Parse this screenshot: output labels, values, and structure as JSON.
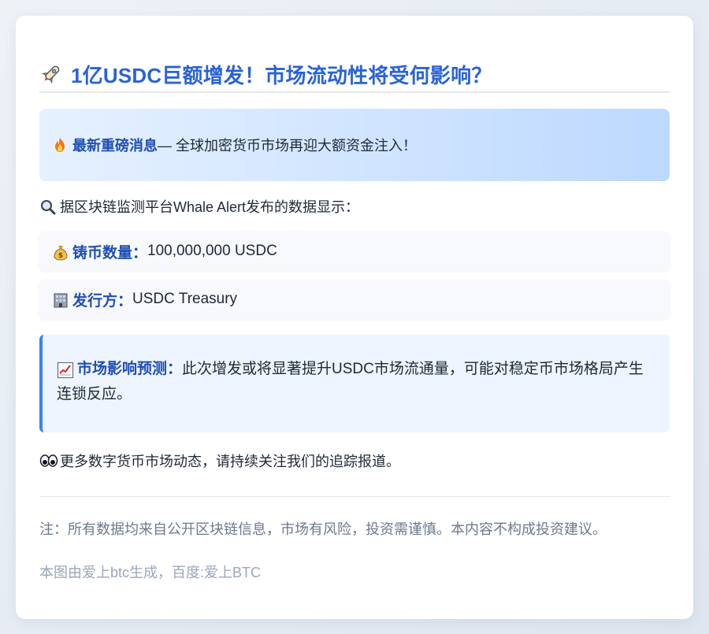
{
  "header": {
    "title": "1亿USDC巨额增发！市场流动性将受何影响？",
    "icon": "rocket-icon"
  },
  "breaking": {
    "icon": "fire-icon",
    "label": "最新重磅消息",
    "text": " — 全球加密货币市场再迎大额资金注入！"
  },
  "source": {
    "icon": "magnifier-icon",
    "text": "据区块链监测平台Whale Alert发布的数据显示："
  },
  "stats": [
    {
      "icon": "money-bag-icon",
      "label": "铸币数量：",
      "value": "100,000,000 USDC"
    },
    {
      "icon": "office-building-icon",
      "label": "发行方：",
      "value": "USDC Treasury"
    }
  ],
  "impact": {
    "icon": "chart-up-icon",
    "label": "市场影响预测：",
    "text": "此次增发或将显著提升USDC市场流通量，可能对稳定币市场格局产生连锁反应。"
  },
  "follow": {
    "icon": "eyes-icon",
    "text": "更多数字货币市场动态，请持续关注我们的追踪报道。"
  },
  "footer": {
    "note": "注：所有数据均来自公开区块链信息，市场有风险，投资需谨慎。本内容不构成投资建议。",
    "credit": "本图由爱上btc生成，百度:爱上BTC"
  },
  "colors": {
    "accent": "#2a63d6",
    "label": "#1f4fb3",
    "impact_border": "#3b82f6"
  }
}
